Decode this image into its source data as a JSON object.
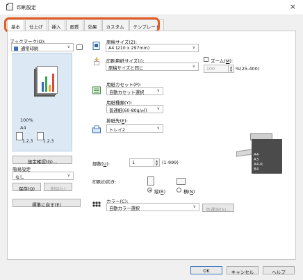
{
  "window": {
    "title": "印刷設定",
    "close": "×"
  },
  "tabs": [
    "基本",
    "仕上げ",
    "挿入",
    "画質",
    "効果",
    "カスタム",
    "テンプレート"
  ],
  "favorites": {
    "label": "ブックマーク(",
    "hotkey": "Q",
    "label_suffix": "):",
    "value": "通常印刷"
  },
  "preview": {
    "zoom": "100%",
    "paper": "A4",
    "copies_label_1": "1.2.3",
    "copies_label_2": "1.2.3"
  },
  "left_buttons": {
    "confirm": "設定確認(G)...",
    "simple_settings": "簡易設定",
    "simple_value": "なし",
    "save": "保存(Q)",
    "delete": "削除(L)",
    "restore": "標準に戻す(E)"
  },
  "original_size": {
    "label": "原稿サイズ(",
    "hotkey": "Z",
    "label_suffix": "):",
    "value": "A4 (210 x 297mm)"
  },
  "print_paper_size": {
    "label": "印刷用紙サイズ(",
    "hotkey": "I",
    "label_suffix": "):",
    "value": "原稿サイズと同じ"
  },
  "zoom": {
    "label": "ズーム(",
    "hotkey": "M",
    "label_suffix": "):",
    "value": "100",
    "range": "%(25-400)"
  },
  "paper_source": {
    "label": "用紙カセット(",
    "hotkey": "P",
    "label_suffix": "):",
    "value": "自動カセット選択"
  },
  "paper_type": {
    "label": "用紙種類(",
    "hotkey": "Y",
    "label_suffix": "):",
    "value": "普通紙(60-80g/㎡)"
  },
  "output_tray": {
    "label": "排紙先(",
    "hotkey": "E",
    "label_suffix": "):",
    "value": "トレイ2"
  },
  "printer_trays": [
    "A4",
    "A3",
    "A4-R",
    "B4"
  ],
  "copies": {
    "label": "部数(",
    "hotkey": "U",
    "label_suffix": "):",
    "value": "1",
    "range": "(1-999)"
  },
  "orientation": {
    "label": "印刷の向き:",
    "portrait": "縦(",
    "portrait_hotkey": "R",
    "landscape": "横(",
    "landscape_hotkey": "N",
    "suffix": ")"
  },
  "color": {
    "label": "カラー(",
    "hotkey": "C",
    "label_suffix": "):",
    "value": "自動カラー選択",
    "color_select": "色選択(S)..."
  },
  "footer": {
    "ok": "OK",
    "cancel": "キャンセル",
    "help": "ヘルプ"
  },
  "colors": {
    "accent": "#e65a24",
    "dialog": "#f0f0f0",
    "preview_bg": "#dce9f5"
  }
}
